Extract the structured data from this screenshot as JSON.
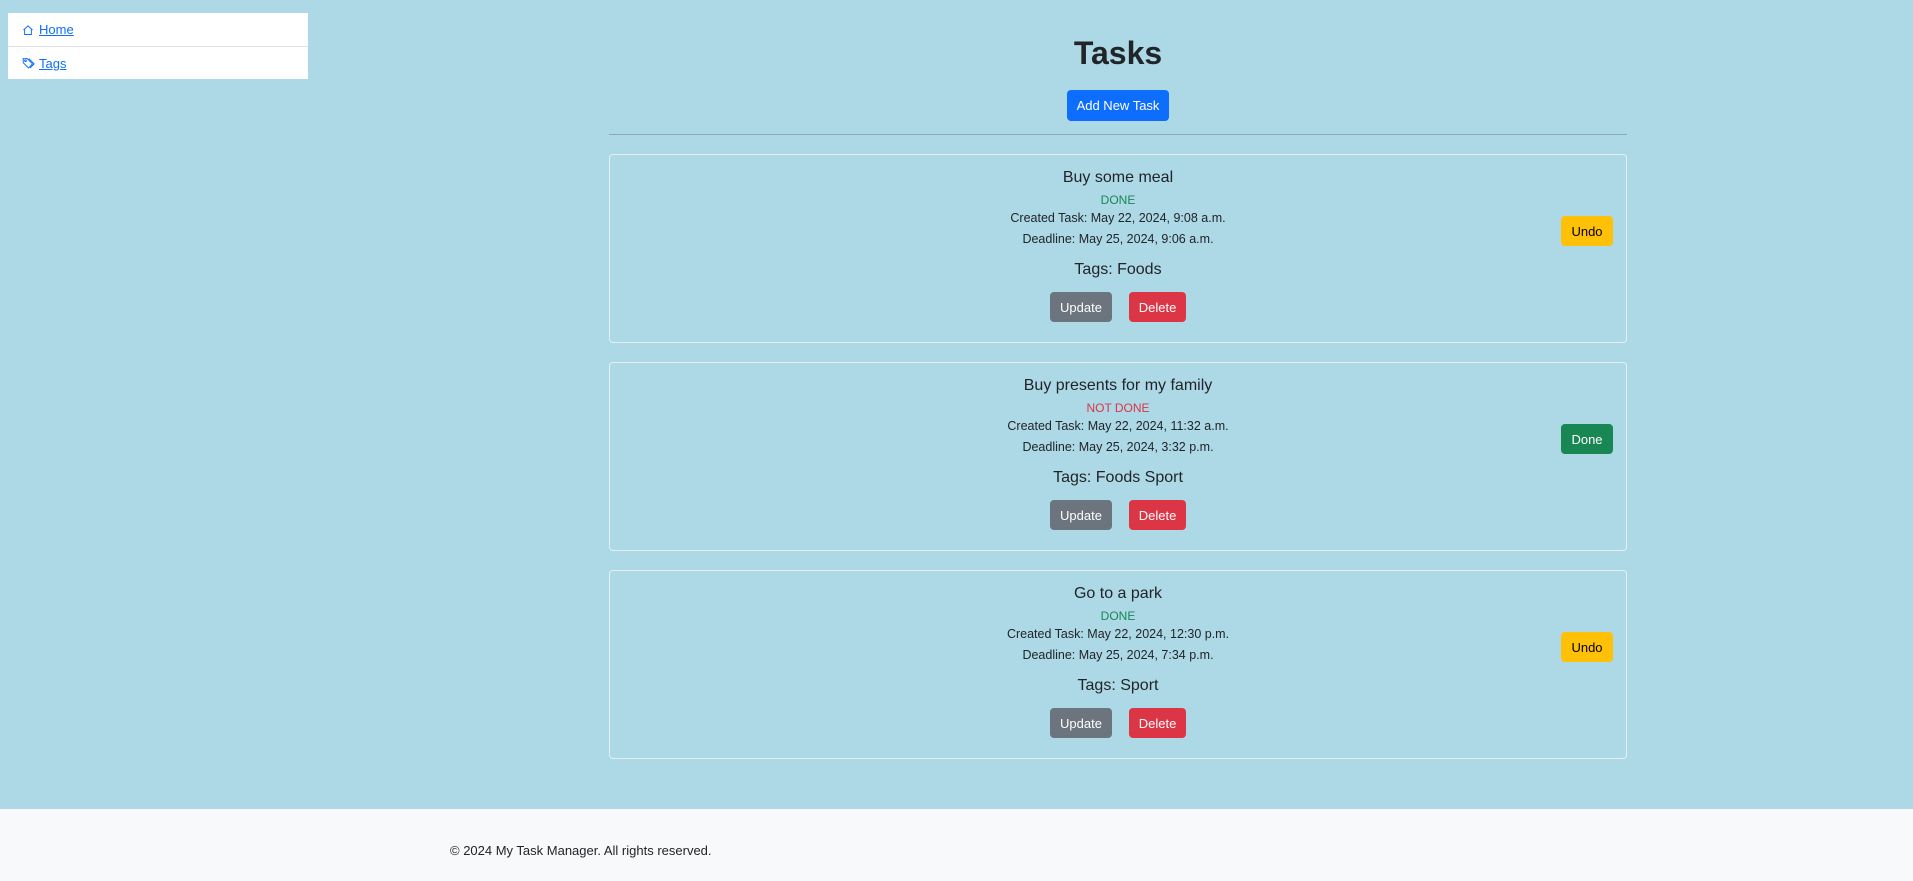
{
  "sidebar": {
    "items": [
      {
        "icon": "home-icon",
        "label": "Home"
      },
      {
        "icon": "tag-icon",
        "label": "Tags"
      }
    ]
  },
  "page": {
    "title": "Tasks",
    "add_button": "Add New Task"
  },
  "tasks": [
    {
      "title": "Buy some meal",
      "status": "DONE",
      "created": "Created Task: May 22, 2024, 9:08 a.m.",
      "deadline": "Deadline: May 25, 2024, 9:06 a.m.",
      "tags": "Tags: Foods",
      "toggle_label": "Undo",
      "update_label": "Update",
      "delete_label": "Delete"
    },
    {
      "title": "Buy presents for my family",
      "status": "NOT DONE",
      "created": "Created Task: May 22, 2024, 11:32 a.m.",
      "deadline": "Deadline: May 25, 2024, 3:32 p.m.",
      "tags": "Tags: Foods Sport",
      "toggle_label": "Done",
      "update_label": "Update",
      "delete_label": "Delete"
    },
    {
      "title": "Go to a park",
      "status": "DONE",
      "created": "Created Task: May 22, 2024, 12:30 p.m.",
      "deadline": "Deadline: May 25, 2024, 7:34 p.m.",
      "tags": "Tags: Sport",
      "toggle_label": "Undo",
      "update_label": "Update",
      "delete_label": "Delete"
    }
  ],
  "footer": {
    "text": "© 2024 My Task Manager. All rights reserved."
  },
  "colors": {
    "background": "#add8e6",
    "primary": "#0d6efd",
    "done": "#198754",
    "not_done": "#dc3545",
    "warning": "#ffc107",
    "secondary": "#6c757d"
  }
}
